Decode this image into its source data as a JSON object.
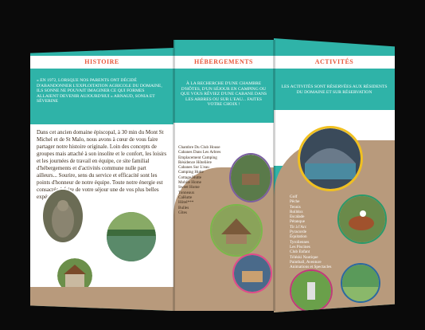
{
  "brochure": {
    "left": {
      "title": "HISTOIRE",
      "intro": "« EN 1972, LORSQUE NOS PARENTS ONT DÉCIDÉ D'ABANDONNER L'EXPLOITATION AGRICOLE DU DOMAINE, ILS SONNE NE POUVAIT IMAGINER CE QUI FORMES ALLAIENT DEVENIR AUJOURD'HUI » ARNAUD, SONIA ET SÉVERINE",
      "body": "Dans cet ancien domaine épiscopal, à 30 min du Mont St Michel et de St Malo, nous avons à cœur de vous faire partager notre histoire originale. Loin des concepts de groupes mais attaché à son insolite et le confort, les loisirs et les journées de travail en équipe, ce site familial d'hébergements et d'activités commune nulle part ailleurs... Sourire, sens du service et efficacité sont les points d'honneur de notre équipe. Toute notre énergie est consacrée à faire de votre séjour une de vos plus belles expériences."
    },
    "middle": {
      "title": "HÉBERGEMENTS",
      "intro": "À LA RECHERCHE D'UNE CHAMBRE D'HÔTES, D'UN SÉJOUR EN CAMPING OU QUE VOUS RÊVIEZ D'UNE CABANE DANS LES ARBRES OU SUR L'EAU... FAITES VOTRE CHOIX !",
      "items": [
        "Chambre Du Club House",
        "Cabanes Dans Les Arbres",
        "Emplacement Camping",
        "Résidence Hôtelière",
        "Cabanes Sur L'eau",
        "Camping Hutte",
        "Cottage/Hutte",
        "Mobile Home",
        "Sweet Home",
        "Tonneaux",
        "CaHutte",
        "Hôtel***",
        "Bulles",
        "Gîtes"
      ]
    },
    "right": {
      "title": "ACTIVITÉS",
      "intro": "LES ACTIVITÉS SONT RÉSERVÉES AUX RÉSIDENTS DU DOMAINE ET SUR RÉSERVATION",
      "items": [
        "Golf",
        "Pêche",
        "Tennis",
        "Rolldox",
        "Escalade",
        "Pétanque",
        "Tir à l'Arc",
        "Pyracorde",
        "Équitation",
        "Tyroliennes",
        "Les Piscines",
        "Club Enfant",
        "Téléski Nautique",
        "Paintball, Aventure",
        "Animations et Spectacles"
      ]
    },
    "colors": {
      "teal": "#2fb3a8",
      "orange_title": "#e8563a",
      "tan": "#b89a7c"
    }
  }
}
